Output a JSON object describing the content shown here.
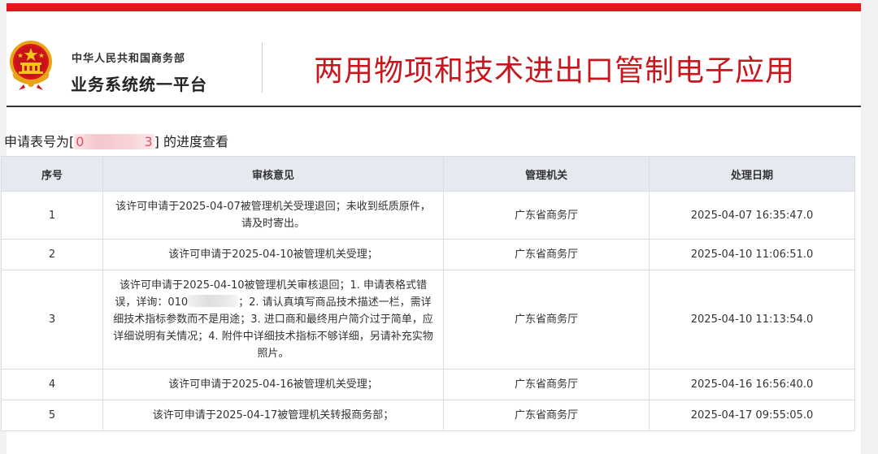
{
  "header": {
    "org_line1": "中华人民共和国商务部",
    "org_line2": "业务系统统一平台",
    "app_title": "两用物项和技术进出口管制电子应用",
    "brand_color": "#e8141c"
  },
  "query": {
    "prefix": "申请表号为[",
    "masked_start": "0",
    "masked_end": "3",
    "suffix": "] 的进度查看"
  },
  "table": {
    "headers": [
      "序号",
      "审核意见",
      "管理机关",
      "处理日期"
    ],
    "rows": [
      {
        "index": "1",
        "opinion": "该许可申请于2025-04-07被管理机关受理退回；未收到纸质原件，请及时寄出。",
        "authority": "广东省商务厅",
        "date": "2025-04-07 16:35:47.0"
      },
      {
        "index": "2",
        "opinion": "该许可申请于2025-04-10被管理机关受理；",
        "authority": "广东省商务厅",
        "date": "2025-04-10 11:06:51.0"
      },
      {
        "index": "3",
        "opinion_before_phone": "该许可申请于2025-04-10被管理机关审核退回；1. 申请表格式错误，详询：010",
        "opinion_after_phone": "；2. 请认真填写商品技术描述一栏，需详细技术指标参数而不是用途；3. 进口商和最终用户简介过于简单，应详细说明有关情况；4. 附件中详细技术指标不够详细，另请补充实物照片。",
        "authority": "广东省商务厅",
        "date": "2025-04-10 11:13:54.0"
      },
      {
        "index": "4",
        "opinion": "该许可申请于2025-04-16被管理机关受理；",
        "authority": "广东省商务厅",
        "date": "2025-04-16 16:56:40.0"
      },
      {
        "index": "5",
        "opinion": "该许可申请于2025-04-17被管理机关转报商务部；",
        "authority": "广东省商务厅",
        "date": "2025-04-17 09:55:05.0"
      }
    ]
  }
}
